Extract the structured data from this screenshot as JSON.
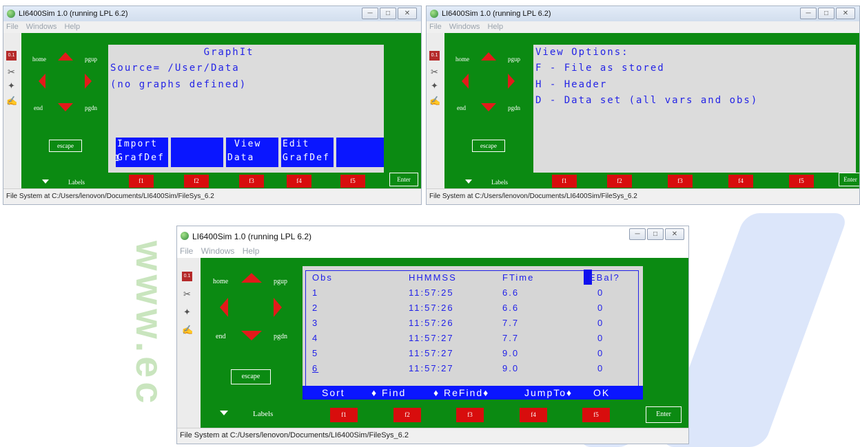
{
  "colors": {
    "panel_green": "#0b8a12",
    "fkey_red": "#d80d0d",
    "screen_bg": "#dcdcdc",
    "screen_text": "#2424e6",
    "softkey_blue": "#0a16ff"
  },
  "watermark": {
    "text": "www.ec"
  },
  "window_common": {
    "menu": [
      "File",
      "Windows",
      "Help"
    ],
    "nav": {
      "home": "home",
      "pgup": "pgup",
      "end": "end",
      "pgdn": "pgdn"
    },
    "escape": "escape",
    "labels": "Labels",
    "fkeys": [
      "f1",
      "f2",
      "f3",
      "f4",
      "f5"
    ],
    "enter": "Enter",
    "toolbar_icons": [
      "memory-chip-icon",
      "tools-icon",
      "satellite-icon",
      "graph-pen-icon"
    ],
    "status": "File System at C:/Users/lenovon/Documents/LI6400Sim/FileSys_6.2",
    "win_buttons": [
      "minimize-icon",
      "maximize-icon",
      "close-icon"
    ],
    "win_btn_glyphs": [
      "─",
      "□",
      "✕"
    ]
  },
  "window1": {
    "title": "LI6400Sim 1.0 (running LPL 6.2)",
    "screen_lines": [
      "             GraphIt",
      "Source= /User/Data",
      "(no graphs defined)"
    ],
    "softkeys": [
      {
        "l1": "Import",
        "l2": "GrafDef",
        "pre": "1"
      },
      {
        "l1": "",
        "l2": ""
      },
      {
        "l1": "View",
        "l2": "Data"
      },
      {
        "l1": "Edit",
        "l2": "GrafDef"
      },
      {
        "l1": "",
        "l2": ""
      }
    ]
  },
  "window2": {
    "title": "LI6400Sim 1.0 (running LPL 6.2)",
    "screen_lines": [
      "View Options:",
      "F - File as stored",
      "H - Header",
      "D - Data set (all vars and obs)"
    ]
  },
  "window3": {
    "title": "LI6400Sim 1.0 (running LPL 6.2)",
    "columns": [
      "Obs",
      "HHMMSS",
      "FTime",
      "EBal?"
    ],
    "rows": [
      [
        "1",
        "11:57:25",
        "6.6",
        "0"
      ],
      [
        "2",
        "11:57:26",
        "6.6",
        "0"
      ],
      [
        "3",
        "11:57:26",
        "7.7",
        "0"
      ],
      [
        "4",
        "11:57:27",
        "7.7",
        "0"
      ],
      [
        "5",
        "11:57:27",
        "9.0",
        "0"
      ],
      [
        "6",
        "11:57:27",
        "9.0",
        "0"
      ]
    ],
    "menu_items": [
      "Sort",
      "♦ Find",
      "♦ ReFind♦",
      "JumpTo♦",
      "OK"
    ]
  }
}
